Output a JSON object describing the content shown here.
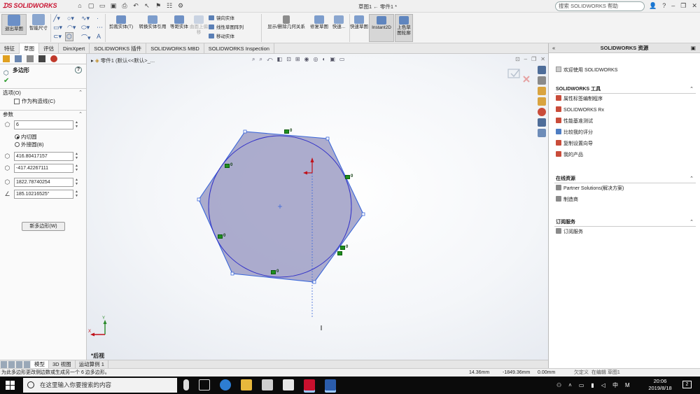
{
  "titlebar": {
    "logo_text": "SOLIDWORKS",
    "doc_title": "草图1 ← 零件1 *",
    "help_search_placeholder": "搜索 SOLIDWORKS 帮助"
  },
  "ribbon": {
    "exit_sketch": "退出草图",
    "smart_dimension": "智能尺寸",
    "trim_entities": "剪裁实体(T)",
    "convert_entities": "转换实体引用",
    "offset_entities": "等距实体",
    "offset_on_surface": "曲面上偏移",
    "mirror_entities": "镜向实体",
    "linear_pattern": "线性草图阵列",
    "move_entities": "移动实体",
    "display_relations": "显示/删除几何关系",
    "repair_sketch": "修复草图",
    "quick_snaps": "快速...",
    "rapid_sketch": "快速草图",
    "instant2d": "Instant2D",
    "shaded_contours": "上色草图轮廓"
  },
  "cmd_tabs": [
    "特征",
    "草图",
    "评估",
    "DimXpert",
    "SOLIDWORKS 插件",
    "SOLIDWORKS MBD",
    "SOLIDWORKS Inspection"
  ],
  "property_manager": {
    "title": "多边形",
    "options_title": "选项(O)",
    "construction_label": "作为构造线(C)",
    "params_title": "参数",
    "sides": "6",
    "inscribed_label": "内切圆",
    "circumscribed_label": "外接圆(B)",
    "center_x": "416.80417157",
    "center_y": "-417.42267111",
    "diameter": "1822.78740254",
    "angle": "185.10216525°",
    "new_polygon_button": "新多边形(W)"
  },
  "graphics": {
    "tree_text": "零件1 (默认<<默认>_...",
    "view_label": "*后视"
  },
  "model_tabs": [
    "模型",
    "3D 视图",
    "运动算例 1"
  ],
  "status": {
    "message": "为此多边形更改侧边数或生成另一个 6 边多边形。",
    "x": "14.36mm",
    "y": "-1849.36mm",
    "z": "0.00mm",
    "state": "欠定义",
    "editing": "在编辑 草图1"
  },
  "taskpane": {
    "title": "SOLIDWORKS 资源",
    "welcome": "欢迎使用 SOLIDWORKS",
    "tools_title": "SOLIDWORKS 工具",
    "tools": [
      "属性标签编制程序",
      "SOLIDWORKS Rx",
      "性能基准测试",
      "比较我的评分",
      "复制设置向导",
      "我的产品"
    ],
    "online_title": "在线资源",
    "online": [
      "Partner Solutions(解决方案)",
      "制造商"
    ],
    "subscription_title": "订阅服务",
    "subscription": [
      "订阅服务"
    ]
  },
  "taskbar": {
    "search_placeholder": "在这里输入你要搜索的内容",
    "time": "20:06",
    "date": "2019/8/18",
    "notifications": "2",
    "ime": "中",
    "ime2": "M"
  },
  "colors": {
    "polygon_fill": "#9e9ec4",
    "polygon_edge": "#3b67d9",
    "relation_green": "#1f8f1f",
    "origin_red": "#c0111a"
  }
}
